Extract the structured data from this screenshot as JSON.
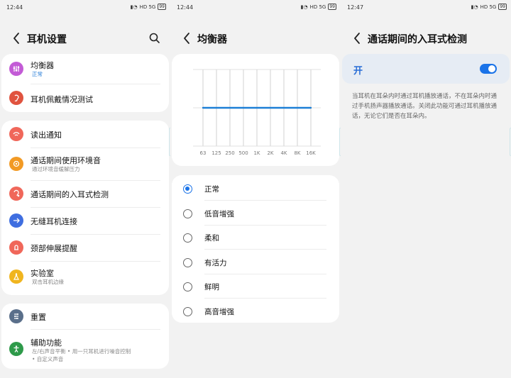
{
  "colors": {
    "accent": "#1a73e8",
    "background": "#f2f2f2",
    "card": "#ffffff"
  },
  "panel1": {
    "status": {
      "time": "12:44",
      "battery": "99",
      "network": "HD 5G"
    },
    "title": "耳机设置",
    "card1": [
      {
        "label": "均衡器",
        "sub": "正常",
        "icon": "equalizer-icon",
        "color": "#c35bd6"
      },
      {
        "label": "耳机佩戴情况测试",
        "icon": "ear-fit-icon",
        "color": "#e0533f"
      }
    ],
    "card2": [
      {
        "label": "读出通知",
        "icon": "notification-read-icon",
        "color": "#f0675a"
      },
      {
        "label": "通话期间使用环境音",
        "sub": "通过环境音缓解压力",
        "icon": "ambient-sound-icon",
        "color": "#f29a24"
      },
      {
        "label": "通话期间的入耳式检测",
        "icon": "in-ear-detection-icon",
        "color": "#f0675a"
      },
      {
        "label": "无缝耳机连接",
        "icon": "seamless-connect-icon",
        "color": "#3f6ee0"
      },
      {
        "label": "颈部伸展提醒",
        "icon": "neck-reminder-icon",
        "color": "#f0675a"
      },
      {
        "label": "实验室",
        "sub": "双击耳机边缘",
        "icon": "lab-flask-icon",
        "color": "#f0b51f"
      }
    ],
    "card3": [
      {
        "label": "重置",
        "icon": "reset-icon",
        "color": "#5a6f8a"
      },
      {
        "label": "辅助功能",
        "sub": "左/右声音平衡  •  用一只耳机进行噪音控制",
        "sub2": "•  自定义声音",
        "icon": "accessibility-icon",
        "color": "#2e9a4a"
      }
    ]
  },
  "panel2": {
    "status": {
      "time": "12:44",
      "battery": "99",
      "network": "HD 5G"
    },
    "title": "均衡器",
    "eq_bands": [
      "63",
      "125",
      "250",
      "500",
      "1K",
      "2K",
      "4K",
      "8K",
      "16K"
    ],
    "eq_gains": [
      0,
      0,
      0,
      0,
      0,
      0,
      0,
      0,
      0
    ],
    "presets": [
      "正常",
      "低音增强",
      "柔和",
      "有活力",
      "鲜明",
      "高音增强"
    ],
    "selected_preset": "正常"
  },
  "panel3": {
    "status": {
      "time": "12:47",
      "battery": "99",
      "network": "HD 5G"
    },
    "title": "通话期间的入耳式检测",
    "toggle_label": "开",
    "toggle_on": true,
    "description": "当耳机在耳朵内时通过耳机播放通话，不在耳朵内时通过手机扬声器播放通话。关闭此功能可通过耳机播放通话，无论它们是否在耳朵内。"
  }
}
